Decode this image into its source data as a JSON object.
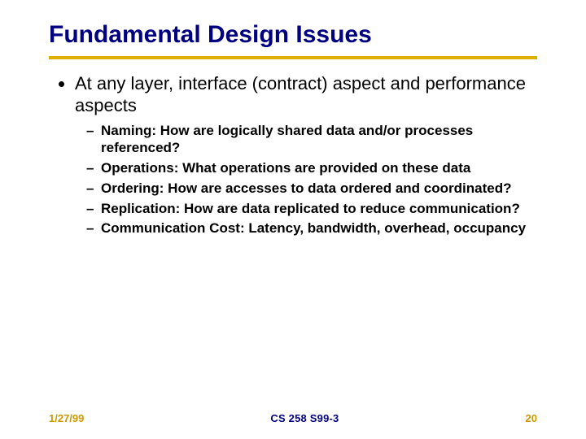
{
  "title": "Fundamental Design Issues",
  "main_bullet": "At any layer, interface (contract) aspect and performance aspects",
  "subpoints": [
    "Naming:  How are logically shared data and/or processes referenced?",
    "Operations: What operations are provided on these data",
    "Ordering:  How are accesses to data ordered and coordinated?",
    "Replication: How are data replicated to reduce communication?",
    "Communication Cost:  Latency, bandwidth, overhead, occupancy"
  ],
  "footer": {
    "date": "1/27/99",
    "course": "CS 258 S99-3",
    "page": "20"
  }
}
